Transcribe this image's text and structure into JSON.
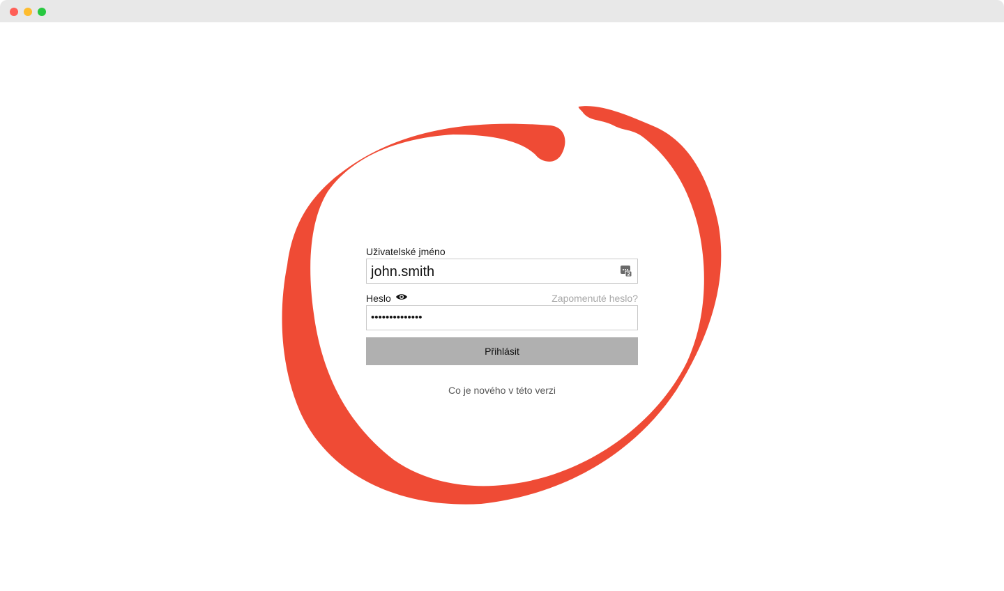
{
  "login": {
    "username_label": "Uživatelské jméno",
    "username_value": "john.smith",
    "password_label": "Heslo",
    "forgot_password": "Zapomenuté heslo?",
    "password_value": "••••••••••••••",
    "submit_label": "Přihlásit",
    "whats_new": "Co je nového v této verzi"
  },
  "icons": {
    "keychain": "keychain-autofill-icon",
    "eye": "eye-icon"
  },
  "colors": {
    "annotation": "#ef4b35",
    "button_bg": "#b0b0b0",
    "link_muted": "#a6a6a6"
  }
}
